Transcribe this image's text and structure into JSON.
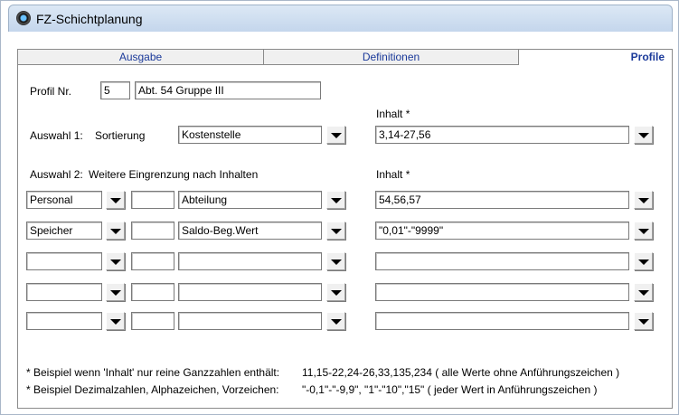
{
  "window": {
    "title": "FZ-Schichtplanung"
  },
  "tabs": [
    {
      "label": "Ausgabe",
      "active": false
    },
    {
      "label": "Definitionen",
      "active": false
    },
    {
      "label": "Profile",
      "active": true
    }
  ],
  "profile": {
    "label": "Profil Nr.",
    "number": "5",
    "name": "Abt. 54 Gruppe III"
  },
  "selection1": {
    "label": "Auswahl 1:",
    "sort_label": "Sortierung",
    "field": "Kostenstelle",
    "content_label": "Inhalt *",
    "content": "3,14-27,56"
  },
  "selection2": {
    "label": "Auswahl 2:",
    "filter_label": "Weitere Eingrenzung nach Inhalten",
    "content_label": "Inhalt *",
    "rows": [
      {
        "category": "Personal",
        "small": "",
        "field": "Abteilung",
        "content": "54,56,57"
      },
      {
        "category": "Speicher",
        "small": "",
        "field": "Saldo-Beg.Wert",
        "content": "\"0,01\"-\"9999\""
      },
      {
        "category": "",
        "small": "",
        "field": "",
        "content": ""
      },
      {
        "category": "",
        "small": "",
        "field": "",
        "content": ""
      },
      {
        "category": "",
        "small": "",
        "field": "",
        "content": ""
      }
    ]
  },
  "notes": {
    "note1_label": "* Beispiel wenn 'Inhalt' nur reine Ganzzahlen enthält:",
    "note1_value": "11,15-22,24-26,33,135,234   ( alle Werte ohne Anführungszeichen )",
    "note2_label": "* Beispiel Dezimalzahlen, Alphazeichen, Vorzeichen:",
    "note2_value": "\"-0,1\"-\"-9,9\", \"1\"-\"10\",\"15\"   ( jeder Wert in Anführungszeichen )"
  },
  "icons": {
    "window": "app-icon",
    "dropdown": "dropdown-arrow-icon"
  }
}
